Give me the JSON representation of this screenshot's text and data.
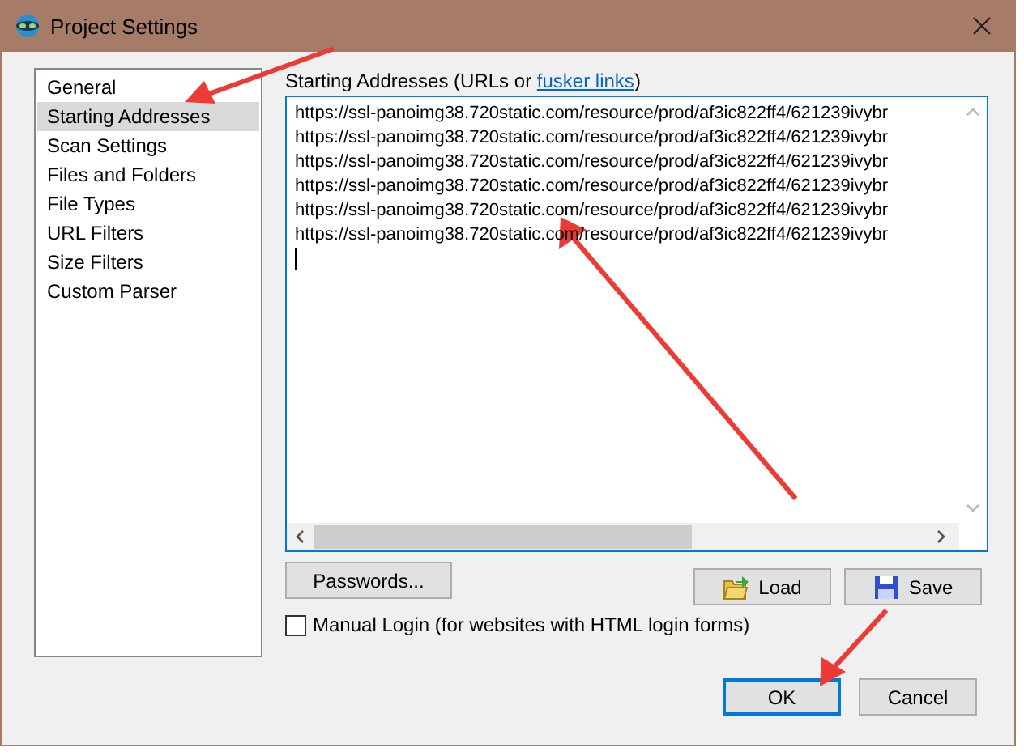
{
  "window": {
    "title": "Project Settings"
  },
  "sidebar": {
    "items": [
      {
        "label": "General",
        "selected": false
      },
      {
        "label": "Starting Addresses",
        "selected": true
      },
      {
        "label": "Scan Settings",
        "selected": false
      },
      {
        "label": "Files and Folders",
        "selected": false
      },
      {
        "label": "File Types",
        "selected": false
      },
      {
        "label": "URL Filters",
        "selected": false
      },
      {
        "label": "Size Filters",
        "selected": false
      },
      {
        "label": "Custom Parser",
        "selected": false
      }
    ]
  },
  "addresses": {
    "label": "Starting Addresses (URLs or ",
    "link": "fusker links",
    "label_end": ")",
    "lines": [
      "https://ssl-panoimg38.720static.com/resource/prod/af3ic822ff4/621239ivybr",
      "https://ssl-panoimg38.720static.com/resource/prod/af3ic822ff4/621239ivybr",
      "https://ssl-panoimg38.720static.com/resource/prod/af3ic822ff4/621239ivybr",
      "https://ssl-panoimg38.720static.com/resource/prod/af3ic822ff4/621239ivybr",
      "https://ssl-panoimg38.720static.com/resource/prod/af3ic822ff4/621239ivybr",
      "https://ssl-panoimg38.720static.com/resource/prod/af3ic822ff4/621239ivybr"
    ]
  },
  "passwords_button": "Passwords...",
  "file_buttons": [
    {
      "kind": "load",
      "label": "Load"
    },
    {
      "kind": "save",
      "label": "Save"
    }
  ],
  "manual_login": {
    "label": "Manual Login (for websites with HTML login forms)",
    "checked": false
  },
  "dialog_buttons": [
    {
      "label": "OK",
      "default": true
    },
    {
      "label": "Cancel",
      "default": false
    }
  ]
}
